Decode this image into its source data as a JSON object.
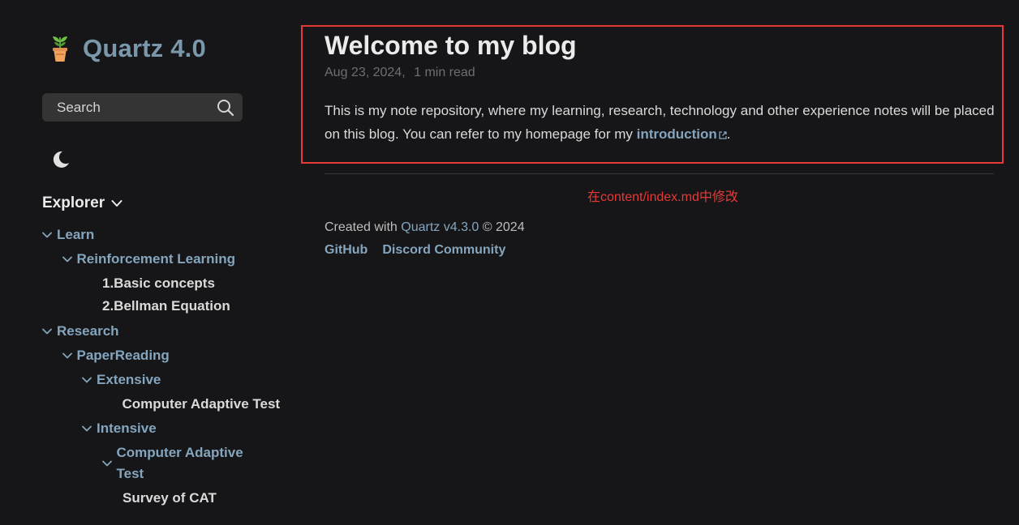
{
  "site": {
    "title": "Quartz 4.0",
    "brand_icon": "potted-plant-icon"
  },
  "search": {
    "label": "Search",
    "icon": "search-icon"
  },
  "darkmode": {
    "icon": "moon-icon"
  },
  "explorer": {
    "title": "Explorer",
    "items": [
      {
        "label": "Learn",
        "type": "folder",
        "depth": 0
      },
      {
        "label": "Reinforcement Learning",
        "type": "folder",
        "depth": 1
      },
      {
        "label": "1.Basic concepts",
        "type": "file",
        "depth": 2
      },
      {
        "label": "2.Bellman Equation",
        "type": "file",
        "depth": 2
      },
      {
        "label": "Research",
        "type": "folder",
        "depth": 0
      },
      {
        "label": "PaperReading",
        "type": "folder",
        "depth": 1
      },
      {
        "label": "Extensive",
        "type": "folder",
        "depth": 2
      },
      {
        "label": "Computer Adaptive Test",
        "type": "file",
        "depth": 3
      },
      {
        "label": "Intensive",
        "type": "folder",
        "depth": 2
      },
      {
        "label": "Computer Adaptive Test",
        "type": "folder",
        "depth": 3
      },
      {
        "label": "Survey of CAT",
        "type": "file",
        "depth": 4
      }
    ]
  },
  "article": {
    "title": "Welcome to my blog",
    "date": "Aug 23, 2024",
    "separator": ",",
    "reading_time": "1 min read",
    "body_before_link": "This is my note repository, where my learning, research, technology and other experience notes will be placed on this blog. You can refer to my homepage for my ",
    "link_text": "introduction",
    "body_after_link": "."
  },
  "annotation": {
    "text": "在content/index.md中修改",
    "color": "#e53935"
  },
  "footer": {
    "created_prefix": "Created with ",
    "quartz_link": "Quartz v4.3.0",
    "created_suffix": " © 2024",
    "links": [
      "GitHub",
      "Discord Community"
    ]
  },
  "colors": {
    "background": "#161618",
    "accent": "#84a5bd",
    "brand": "#7b97aa",
    "text": "#ebebec",
    "muted": "#6f6f72",
    "highlight_border": "#e53935"
  }
}
